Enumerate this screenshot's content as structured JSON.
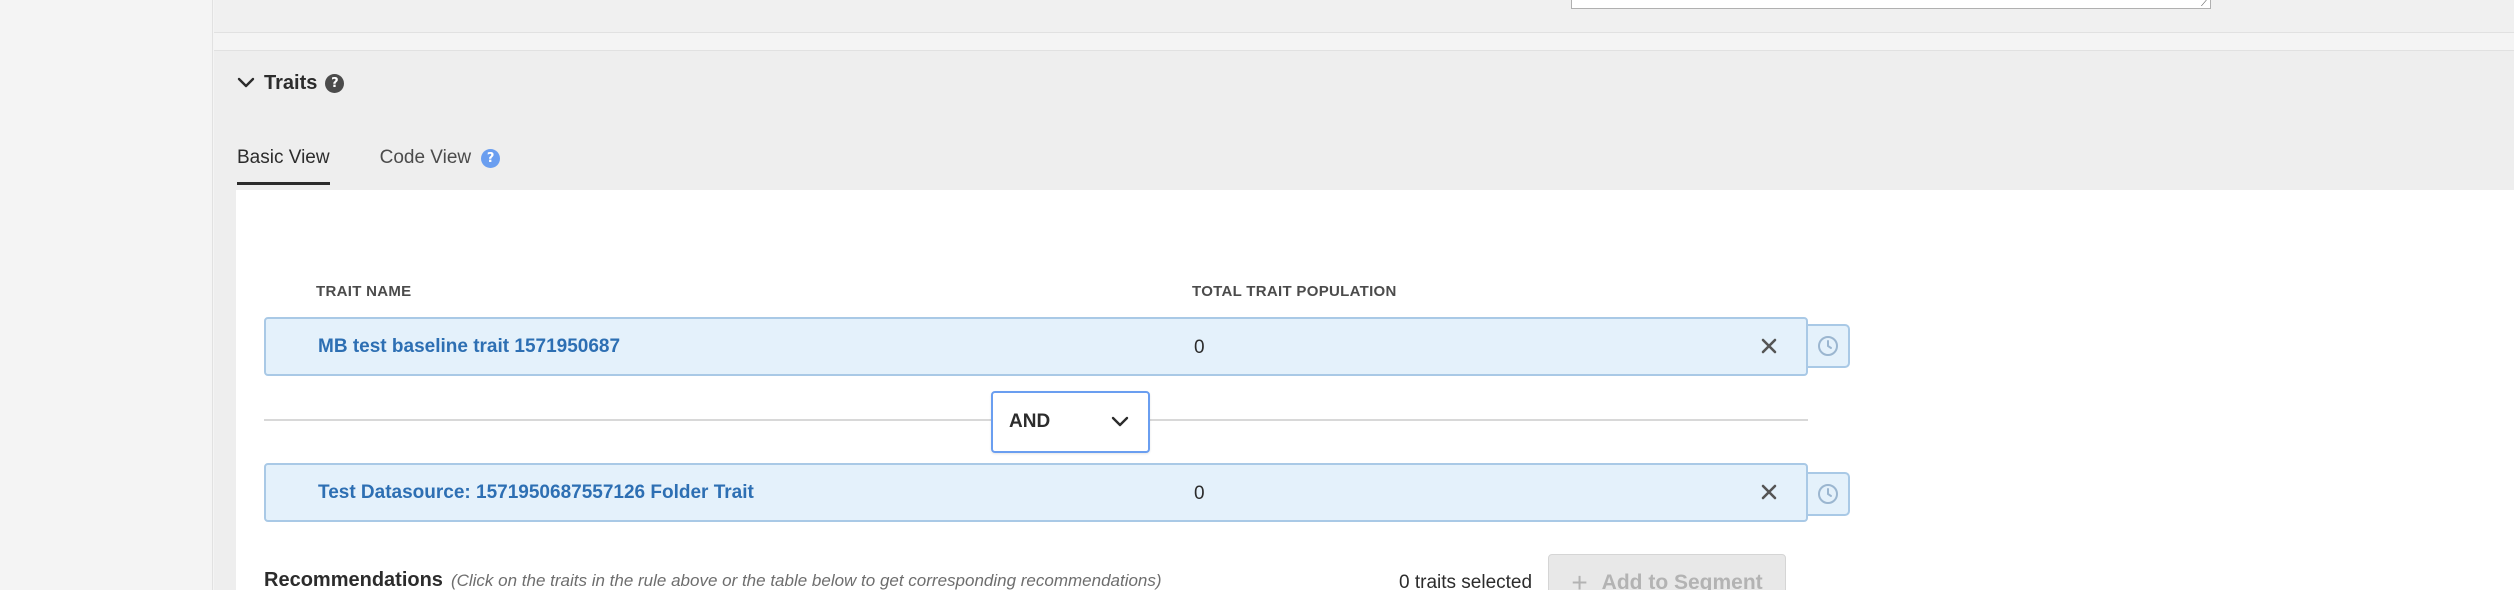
{
  "traits_section": {
    "title": "Traits",
    "help_icon": "help-circle-icon",
    "tabs": [
      {
        "label": "Basic View",
        "active": true
      },
      {
        "label": "Code View",
        "active": false
      }
    ],
    "columns": {
      "trait_name": "TRAIT NAME",
      "population": "TOTAL TRAIT POPULATION"
    },
    "rows": [
      {
        "name": "MB test baseline trait 1571950687",
        "population": "0"
      },
      {
        "name": "Test Datasource: 1571950687557126 Folder Trait",
        "population": "0"
      }
    ],
    "operator": {
      "selected": "AND"
    },
    "recommendations": {
      "title": "Recommendations",
      "hint": "(Click on the traits in the rule above or the table below to get corresponding recommendations)"
    },
    "selected_count": "0 traits selected",
    "add_button": {
      "label": "Add to Segment",
      "disabled": true
    }
  },
  "colors": {
    "row_bg": "#e4f1fb",
    "row_border": "#a9c9e6",
    "link": "#2d6fb3",
    "focus": "#6a9ef0"
  }
}
